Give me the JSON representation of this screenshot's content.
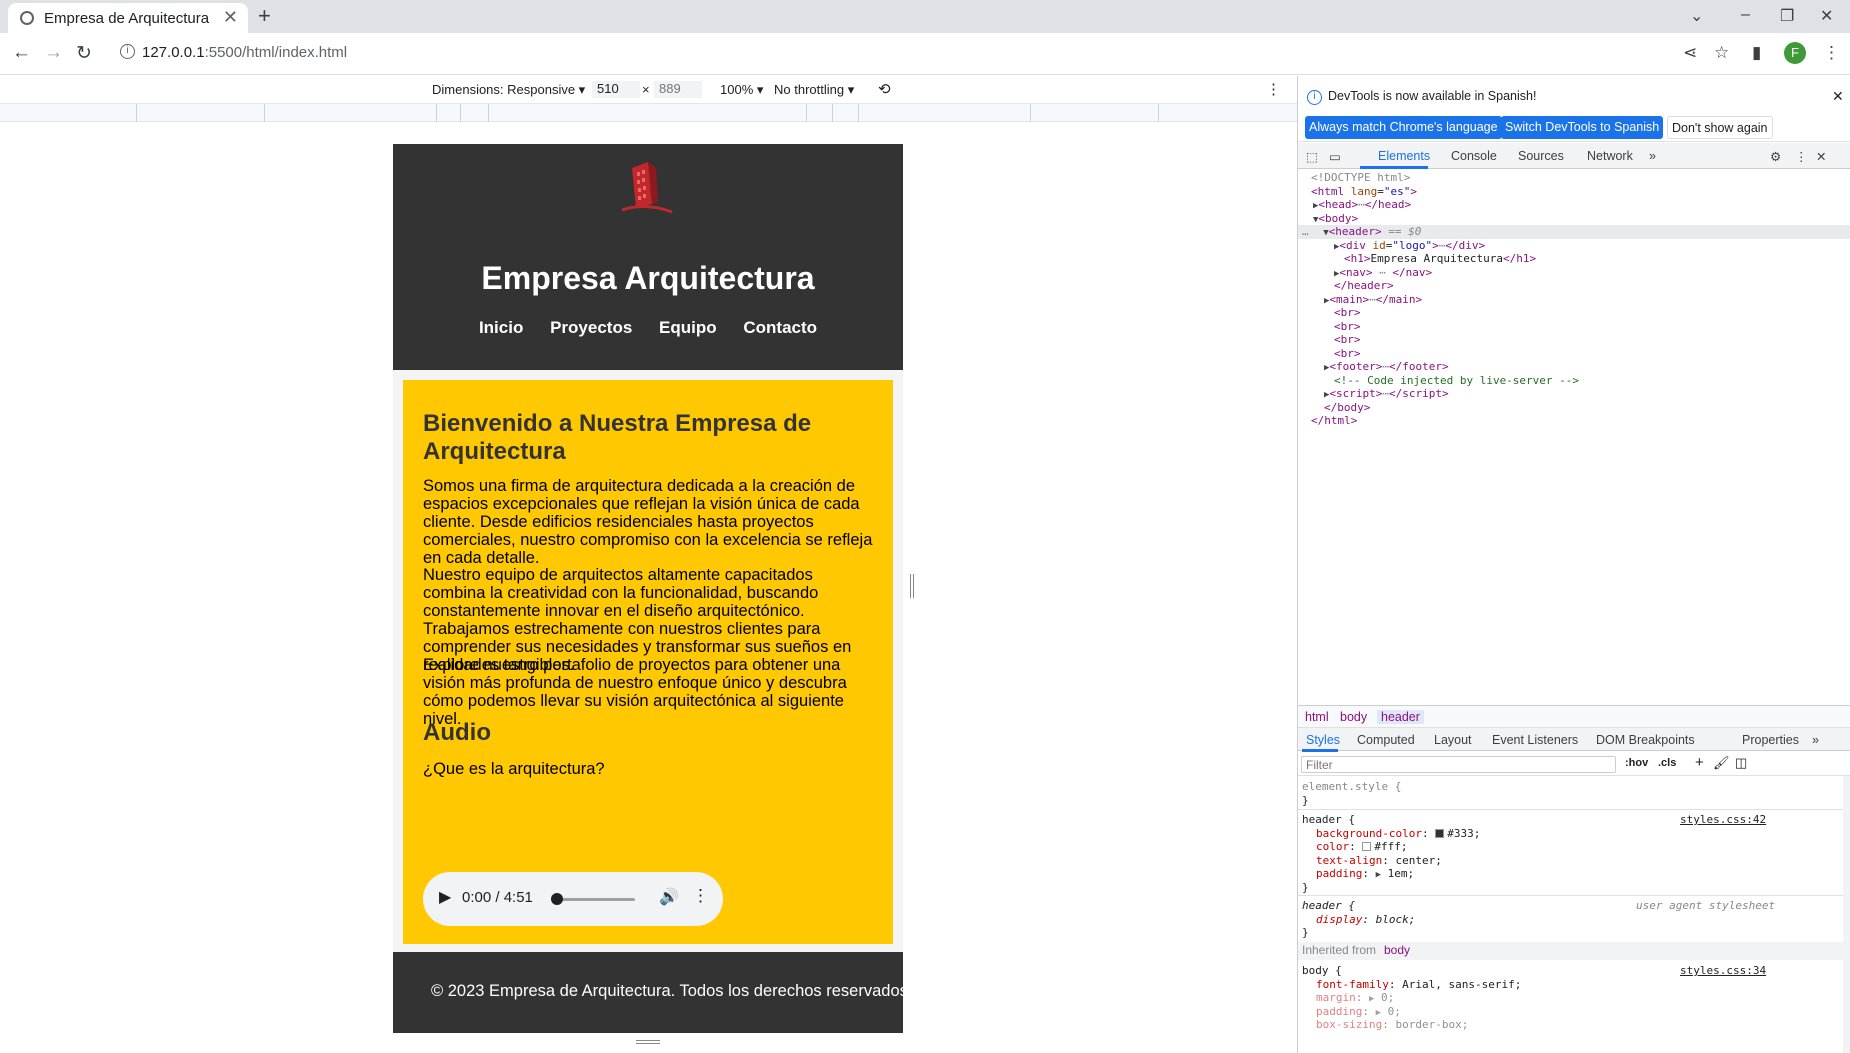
{
  "browser": {
    "tab_title": "Empresa de Arquitectura",
    "tab_close": "✕",
    "new_tab": "+",
    "url_host": "127.0.0.1",
    "url_path": ":5500/html/index.html",
    "avatar_letter": "F"
  },
  "device_toolbar": {
    "dimensions": "Dimensions: Responsive ▾",
    "width": "510",
    "times": "×",
    "height": "889",
    "zoom": "100% ▾",
    "throttle": "No throttling ▾"
  },
  "site": {
    "title": "Empresa Arquitectura",
    "nav": [
      "Inicio",
      "Proyectos",
      "Equipo",
      "Contacto"
    ],
    "welcome_heading": "Bienvenido a Nuestra Empresa de Arquitectura",
    "paragraphs": [
      "Somos una firma de arquitectura dedicada a la creación de espacios excepcionales que reflejan la visión única de cada cliente. Desde edificios residenciales hasta proyectos comerciales, nuestro compromiso con la excelencia se refleja en cada detalle.",
      "Nuestro equipo de arquitectos altamente capacitados combina la creatividad con la funcionalidad, buscando constantemente innovar en el diseño arquitectónico. Trabajamos estrechamente con nuestros clientes para comprender sus necesidades y transformar sus sueños en realidades tangibles.",
      "Explore nuestro portafolio de proyectos para obtener una visión más profunda de nuestro enfoque único y descubra cómo podemos llevar su visión arquitectónica al siguiente nivel."
    ],
    "audio_heading": "Audio",
    "audio_label": "¿Que es la arquitectura?",
    "audio_time": "0:00 / 4:51",
    "footer": "© 2023 Empresa de Arquitectura. Todos los derechos reservados.",
    "header_bg": "#333333",
    "main_bg": "#ffc800"
  },
  "devtools": {
    "info_message": "DevTools is now available in Spanish!",
    "btn_match": "Always match Chrome's language",
    "btn_switch": "Switch DevTools to Spanish",
    "btn_dont": "Don't show again",
    "tabs": [
      "Elements",
      "Console",
      "Sources",
      "Network"
    ],
    "dom": {
      "doctype": "<!DOCTYPE html>",
      "html_open": "html",
      "lang_attr": "lang",
      "lang_val": "\"es\"",
      "head": "head",
      "body": "body",
      "header": "header",
      "dollar": "== $0",
      "div": "div",
      "id_attr": "id",
      "id_val": "\"logo\"",
      "h1_text": "Empresa Arquitectura",
      "nav": "nav",
      "main": "main",
      "br": "br",
      "footer": "footer",
      "comment": "<!-- Code injected by live-server -->",
      "script": "script"
    },
    "breadcrumbs": [
      "html",
      "body",
      "header"
    ],
    "subtabs": [
      "Styles",
      "Computed",
      "Layout",
      "Event Listeners",
      "DOM Breakpoints",
      "Properties"
    ],
    "filter_placeholder": "Filter",
    "hov": ":hov",
    "cls": ".cls",
    "styles": {
      "element_style": "element.style {",
      "close": "}",
      "header_rule": "header {",
      "source1": "styles.css:42",
      "bg_prop": "background-color",
      "bg_val": "#333;",
      "color_prop": "color",
      "color_val": "#fff;",
      "align_prop": "text-align",
      "align_val": "center;",
      "pad_prop": "padding",
      "pad_val": "1em;",
      "ua_rule": "header {",
      "ua_source": "user agent stylesheet",
      "display_prop": "display",
      "display_val": "block;",
      "inherited": "Inherited from",
      "inherited_el": "body",
      "body_rule": "body {",
      "source2": "styles.css:34",
      "font_prop": "font-family",
      "font_val": "Arial, sans-serif;",
      "margin_prop": "margin",
      "margin_val": "0;",
      "padding_prop": "padding",
      "padding_val": "0;",
      "boxsizing_prop": "box-sizing",
      "boxsizing_val": "border-box;"
    }
  }
}
